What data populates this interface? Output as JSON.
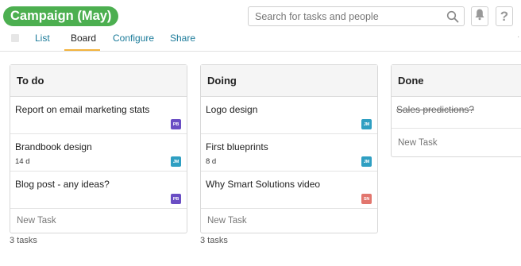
{
  "header": {
    "project_title": "Campaign (May)",
    "search_placeholder": "Search for tasks and people",
    "help_glyph": "?"
  },
  "tabs": [
    {
      "label": "List"
    },
    {
      "label": "Board"
    },
    {
      "label": "Configure"
    },
    {
      "label": "Share"
    }
  ],
  "colors": {
    "brand": "#4caf50",
    "active_tab": "#f3b33d",
    "link": "#1a7a99"
  },
  "columns": [
    {
      "title": "To do",
      "tasks": [
        {
          "title": "Report on email marketing stats",
          "meta": "",
          "assignee": "PB",
          "avatar_color": "#6a4ec4"
        },
        {
          "title": "Brandbook design",
          "meta": "14 d",
          "assignee": "JM",
          "avatar_color": "#2f9fc2"
        },
        {
          "title": "Blog post - any ideas?",
          "meta": "",
          "assignee": "PB",
          "avatar_color": "#6a4ec4"
        }
      ],
      "new_task": "New Task",
      "count": "3 tasks"
    },
    {
      "title": "Doing",
      "tasks": [
        {
          "title": "Logo design",
          "meta": "",
          "assignee": "JM",
          "avatar_color": "#2f9fc2"
        },
        {
          "title": "First blueprints",
          "meta": "8 d",
          "assignee": "JM",
          "avatar_color": "#2f9fc2"
        },
        {
          "title": "Why Smart Solutions video",
          "meta": "",
          "assignee": "SN",
          "avatar_color": "#e2766e"
        }
      ],
      "new_task": "New Task",
      "count": "3 tasks"
    },
    {
      "title": "Done",
      "tasks": [
        {
          "title": "Sales predictions?",
          "meta": "",
          "assignee": "",
          "avatar_color": ""
        }
      ],
      "new_task": "New Task",
      "count": ""
    }
  ]
}
